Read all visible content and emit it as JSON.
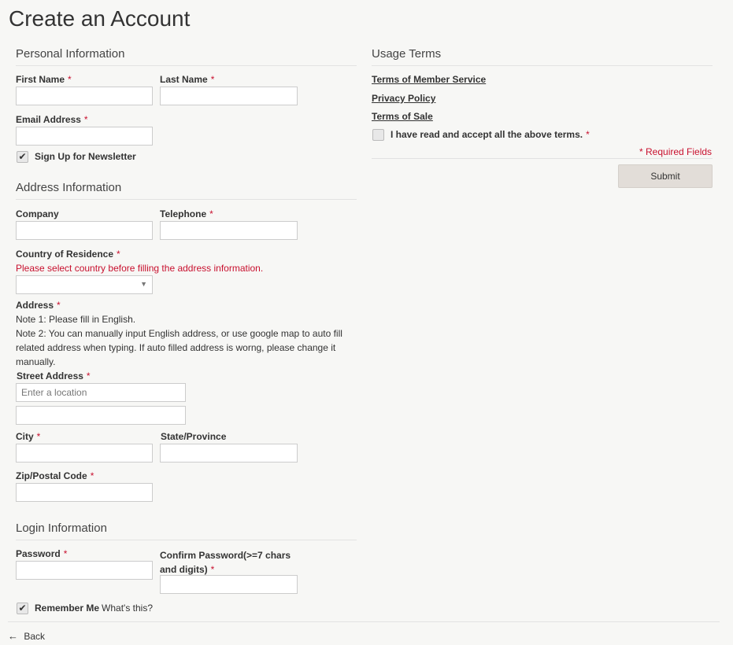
{
  "page_title": "Create an Account",
  "personal": {
    "heading": "Personal Information",
    "first_name": "First Name",
    "last_name": "Last Name",
    "email": "Email Address",
    "newsletter": "Sign Up for Newsletter",
    "newsletter_checked": true
  },
  "address": {
    "heading": "Address Information",
    "company": "Company",
    "telephone": "Telephone",
    "country": "Country of Residence",
    "country_warning": "Please select country before filling the address information.",
    "address_label": "Address",
    "note1": "Note 1: Please fill in English.",
    "note2": "Note 2: You can manually input English address, or use google map to auto fill related address when typing. If auto filled address is worng, please change it manually.",
    "street": "Street Address",
    "street_placeholder": "Enter a location",
    "city": "City",
    "state": "State/Province",
    "zip": "Zip/Postal Code"
  },
  "login": {
    "heading": "Login Information",
    "password": "Password",
    "confirm_line1": "Confirm Password(>=7 chars",
    "confirm_line2": "and digits)",
    "remember": "Remember Me",
    "whats_this": "What's this?",
    "remember_checked": true
  },
  "terms": {
    "heading": "Usage Terms",
    "member_service": "Terms of Member Service",
    "privacy": "Privacy Policy",
    "sale": "Terms of Sale",
    "accept": "I have read and accept all the above terms.",
    "required_fields": "* Required Fields",
    "submit": "Submit"
  },
  "required_mark": "*",
  "back": "Back",
  "icons": {
    "check": "check-icon",
    "back": "arrow-left-icon",
    "caret": "caret-down-icon"
  },
  "colors": {
    "required": "#c8102e",
    "background": "#f7f7f5",
    "button": "#e2ddd8"
  }
}
